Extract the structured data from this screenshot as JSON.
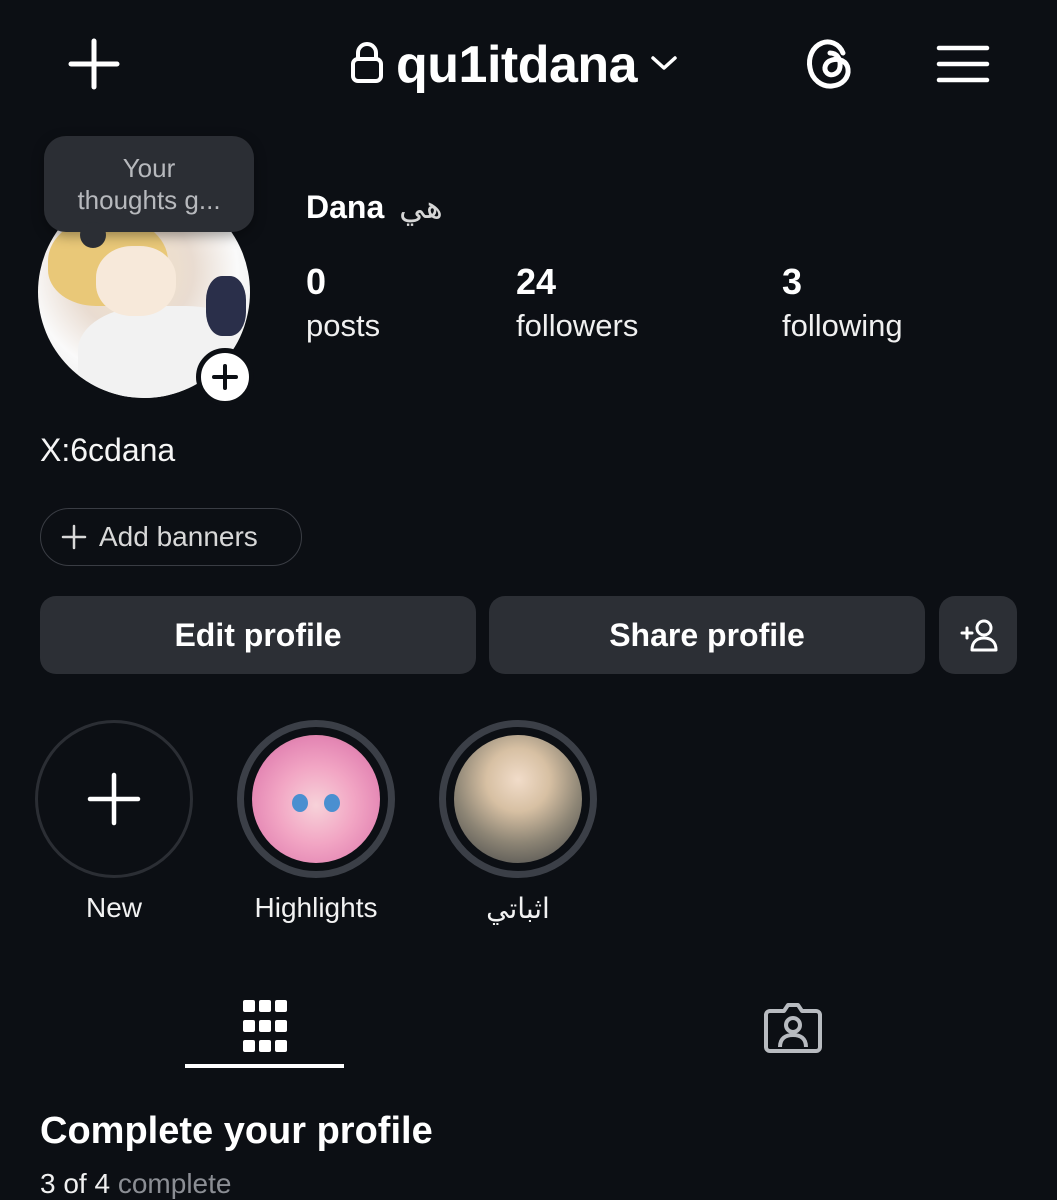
{
  "header": {
    "username": "qu1itdana",
    "icons": [
      "plus-icon",
      "lock-icon",
      "chevron-down-icon",
      "threads-icon",
      "menu-icon"
    ]
  },
  "note": {
    "line1": "Your",
    "line2": "thoughts g..."
  },
  "profile": {
    "display_name": "Dana",
    "pronoun": "هي",
    "stats": [
      {
        "num": "0",
        "label": "posts"
      },
      {
        "num": "24",
        "label": "followers"
      },
      {
        "num": "3",
        "label": "following"
      }
    ],
    "bio": "X:6cdana"
  },
  "banner_button": {
    "label": "Add banners"
  },
  "actions": {
    "edit": "Edit profile",
    "share": "Share profile"
  },
  "highlights": [
    {
      "label": "New"
    },
    {
      "label": "Highlights"
    },
    {
      "label": "اثباتي"
    }
  ],
  "tabs": [
    "grid-icon",
    "tagged-icon"
  ],
  "complete_profile": {
    "title": "Complete your profile",
    "count": "3 of 4",
    "suffix": "complete"
  }
}
